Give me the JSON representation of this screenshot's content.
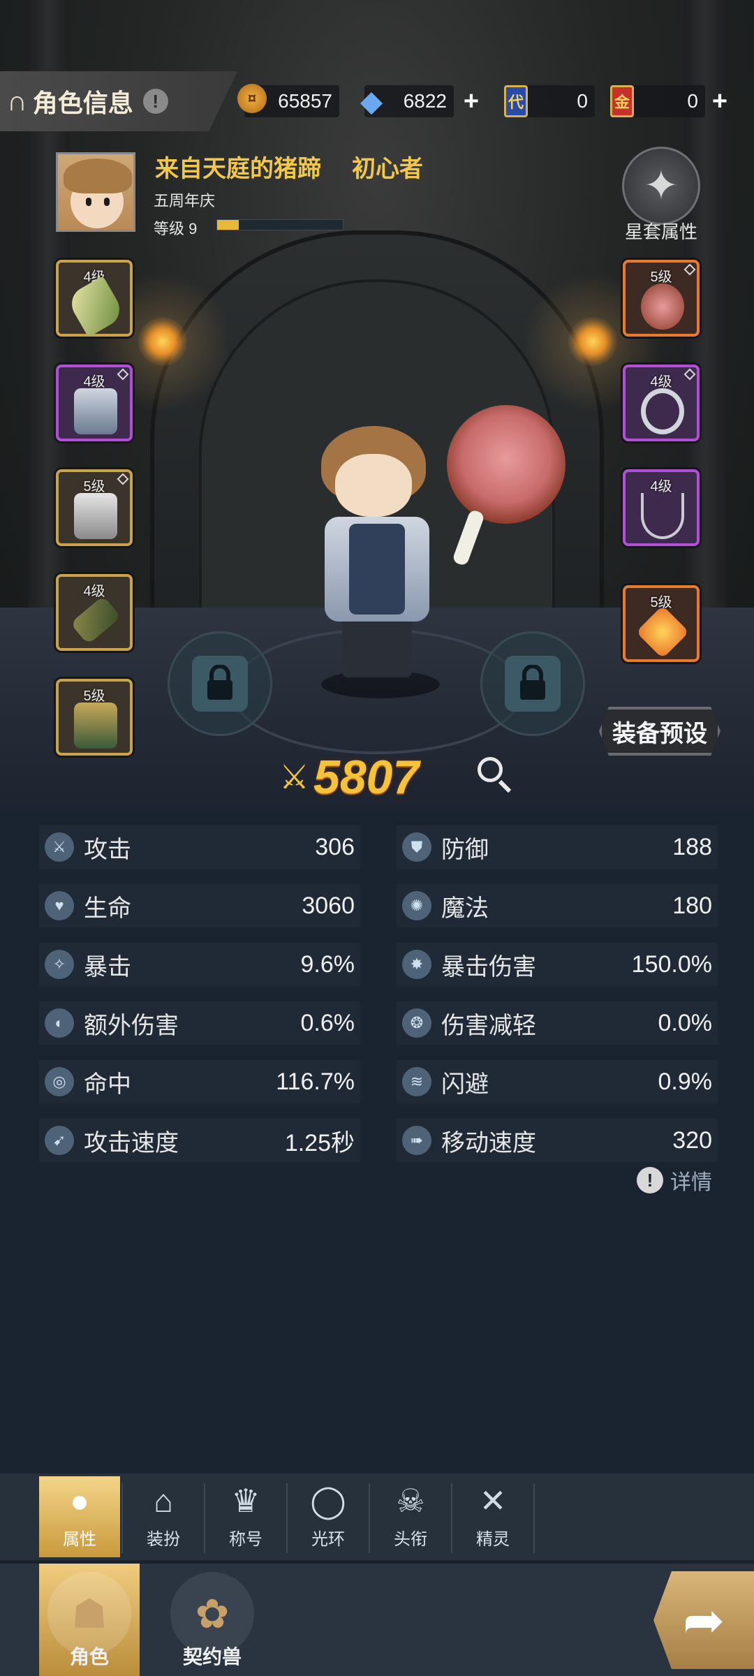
{
  "header": {
    "title": "角色信息",
    "info_icon": "info-icon",
    "resources": [
      {
        "name": "coin",
        "value": "65857",
        "icon": "coin-icon",
        "color": "#d8922a"
      },
      {
        "name": "crystal",
        "value": "6822",
        "icon": "crystal-icon",
        "color": "#5a8fd8"
      },
      {
        "name": "blue-card",
        "value": "0",
        "icon": "blue-card-icon",
        "color": "#2a4aa8"
      },
      {
        "name": "gold-card",
        "value": "0",
        "icon": "gold-card-icon",
        "color": "#c8302a"
      }
    ],
    "resource_card_glyphs": [
      "代",
      "金"
    ]
  },
  "profile": {
    "name": "来自天庭的猪蹄",
    "title": "初心者",
    "subtitle": "五周年庆",
    "level_label": "等级 9",
    "level_progress": 0.17
  },
  "set_attributes": {
    "label": "星套属性"
  },
  "equipment": {
    "left": [
      {
        "level": "4级",
        "rarity": "gold"
      },
      {
        "level": "4级",
        "rarity": "purple"
      },
      {
        "level": "5级",
        "rarity": "gold"
      },
      {
        "level": "4级",
        "rarity": "gold"
      },
      {
        "level": "5级",
        "rarity": "gold"
      }
    ],
    "right": [
      {
        "level": "5级",
        "rarity": "orange"
      },
      {
        "level": "4级",
        "rarity": "purple"
      },
      {
        "level": "4级",
        "rarity": "purple"
      },
      {
        "level": "5级",
        "rarity": "orange"
      }
    ]
  },
  "preset_button": "装备预设",
  "power": "5807",
  "stats": [
    {
      "label": "攻击",
      "value": "306"
    },
    {
      "label": "防御",
      "value": "188"
    },
    {
      "label": "生命",
      "value": "3060"
    },
    {
      "label": "魔法",
      "value": "180"
    },
    {
      "label": "暴击",
      "value": "9.6%"
    },
    {
      "label": "暴击伤害",
      "value": "150.0%"
    },
    {
      "label": "额外伤害",
      "value": "0.6%"
    },
    {
      "label": "伤害减轻",
      "value": "0.0%"
    },
    {
      "label": "命中",
      "value": "116.7%"
    },
    {
      "label": "闪避",
      "value": "0.9%"
    },
    {
      "label": "攻击速度",
      "value": "1.25秒"
    },
    {
      "label": "移动速度",
      "value": "320"
    }
  ],
  "detail_label": "详情",
  "subtabs": [
    "属性",
    "装扮",
    "称号",
    "光环",
    "头衔",
    "精灵"
  ],
  "bottom_nav": [
    "角色",
    "契约兽"
  ],
  "colors": {
    "accent_gold": "#f3c33c",
    "panel": "#1f2a36",
    "background": "#1a2430"
  }
}
